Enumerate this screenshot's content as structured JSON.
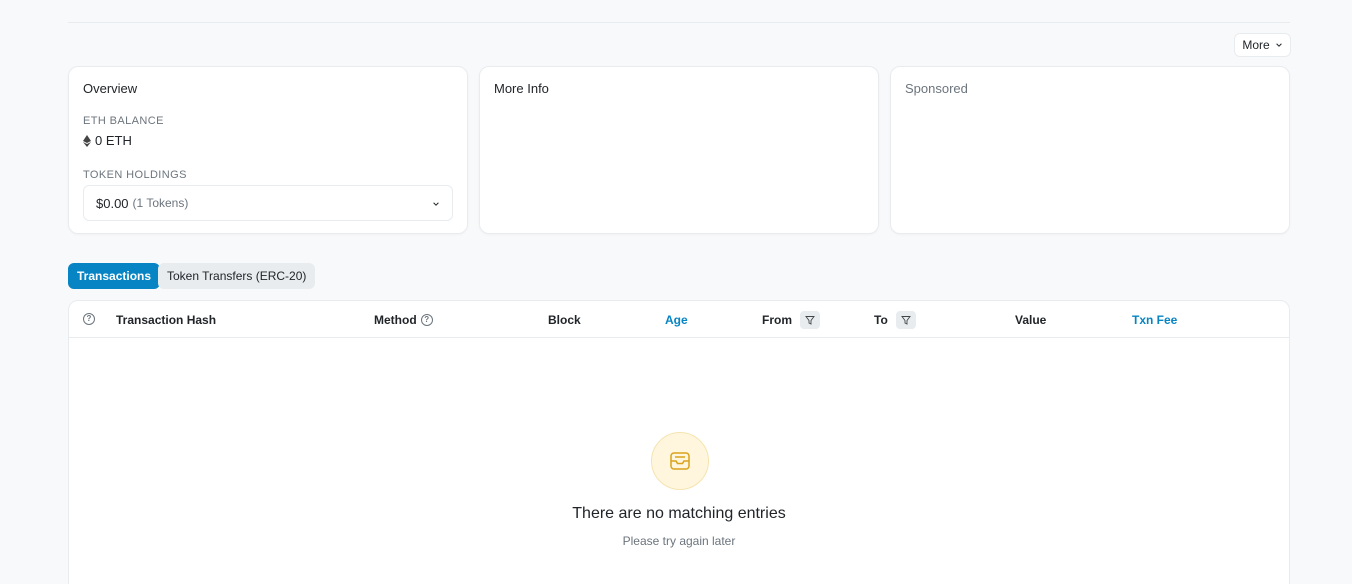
{
  "toolbar": {
    "more_label": "More"
  },
  "overview": {
    "title": "Overview",
    "eth_balance_label": "ETH BALANCE",
    "eth_balance_value": "0 ETH",
    "token_holdings_label": "TOKEN HOLDINGS",
    "token_holdings_value": "$0.00",
    "token_holdings_count": "(1 Tokens)"
  },
  "more_info": {
    "title": "More Info"
  },
  "sponsored": {
    "title": "Sponsored"
  },
  "tabs": [
    {
      "label": "Transactions"
    },
    {
      "label": "Token Transfers (ERC-20)"
    }
  ],
  "table": {
    "columns": {
      "hash": "Transaction Hash",
      "method": "Method",
      "block": "Block",
      "age": "Age",
      "from": "From",
      "to": "To",
      "value": "Value",
      "fee": "Txn Fee"
    },
    "empty_title": "There are no matching entries",
    "empty_subtitle": "Please try again later"
  },
  "colors": {
    "accent": "#0784c3",
    "muted": "#6c757d",
    "border": "#e9ecef",
    "empty_icon": "#d9a21b"
  }
}
